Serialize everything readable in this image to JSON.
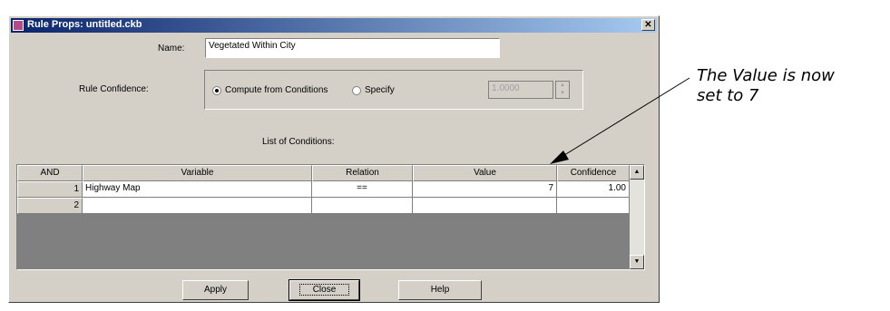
{
  "window": {
    "title": "Rule Props: untitled.ckb",
    "close_glyph": "✕"
  },
  "name_field": {
    "label": "Name:",
    "value": "Vegetated Within City"
  },
  "rule_confidence": {
    "label": "Rule Confidence:",
    "option_compute": "Compute from Conditions",
    "option_specify": "Specify",
    "selected": "Compute from Conditions",
    "specify_value": "1.0000"
  },
  "conditions": {
    "title": "List of Conditions:",
    "columns": [
      "AND",
      "Variable",
      "Relation",
      "Value",
      "Confidence"
    ],
    "rows": [
      {
        "num": "1",
        "variable": "Highway Map",
        "relation": "==",
        "value": "7",
        "confidence": "1.00"
      },
      {
        "num": "2",
        "variable": "",
        "relation": "",
        "value": "",
        "confidence": ""
      }
    ]
  },
  "buttons": {
    "apply": "Apply",
    "close": "Close",
    "help": "Help"
  },
  "annotation": {
    "line1": "The Value is now",
    "line2": "set to 7"
  }
}
